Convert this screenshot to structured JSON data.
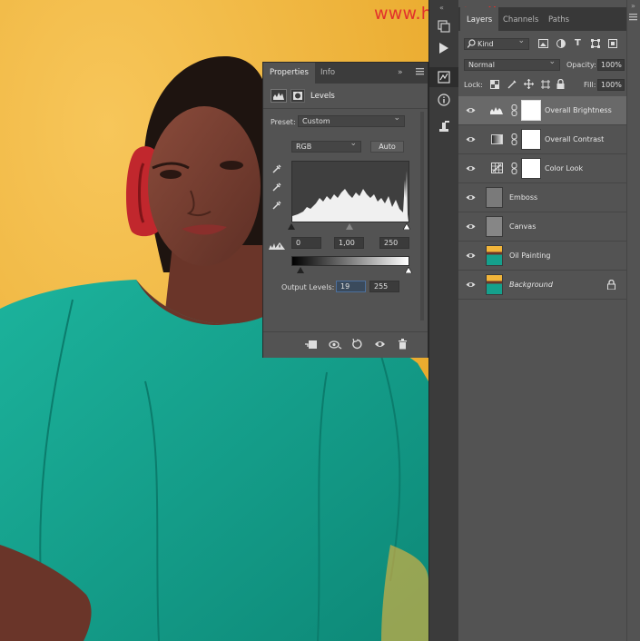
{
  "watermark": "www.hanstudio.com",
  "properties": {
    "tabs": [
      "Properties",
      "Info"
    ],
    "adjustment_title": "Levels",
    "preset_label": "Preset:",
    "preset_value": "Custom",
    "channel_value": "RGB",
    "auto_label": "Auto",
    "input_black": "0",
    "input_gamma": "1,00",
    "input_white": "250",
    "output_label": "Output Levels:",
    "output_black": "19",
    "output_white": "255"
  },
  "layers": {
    "tabs": [
      "Layers",
      "Channels",
      "Paths"
    ],
    "filter_kind": "Kind",
    "blend_mode": "Normal",
    "opacity_label": "Opacity:",
    "opacity_value": "100%",
    "lock_label": "Lock:",
    "fill_label": "Fill:",
    "fill_value": "100%",
    "items": [
      {
        "name": "Overall Brightness",
        "type": "levels",
        "selected": true
      },
      {
        "name": "Overall Contrast",
        "type": "gradient",
        "selected": false
      },
      {
        "name": "Color Look",
        "type": "lookup",
        "selected": false
      },
      {
        "name": "Emboss",
        "type": "gray",
        "selected": false
      },
      {
        "name": "Canvas",
        "type": "gray",
        "selected": false
      },
      {
        "name": "Oil Painting",
        "type": "photo",
        "selected": false
      },
      {
        "name": "Background",
        "type": "photo",
        "selected": false,
        "locked": true
      }
    ]
  },
  "colors": {
    "panel": "#535353",
    "panel_dark": "#3c3c3c",
    "photo_bg": "#f2b53a",
    "dress": "#15a08c",
    "watermark": "#e2322c"
  },
  "icons": [
    "eye-icon",
    "chain-link-icon",
    "lock-icon",
    "trash-icon",
    "play-icon",
    "info-icon",
    "histogram-icon",
    "mask-icon"
  ]
}
